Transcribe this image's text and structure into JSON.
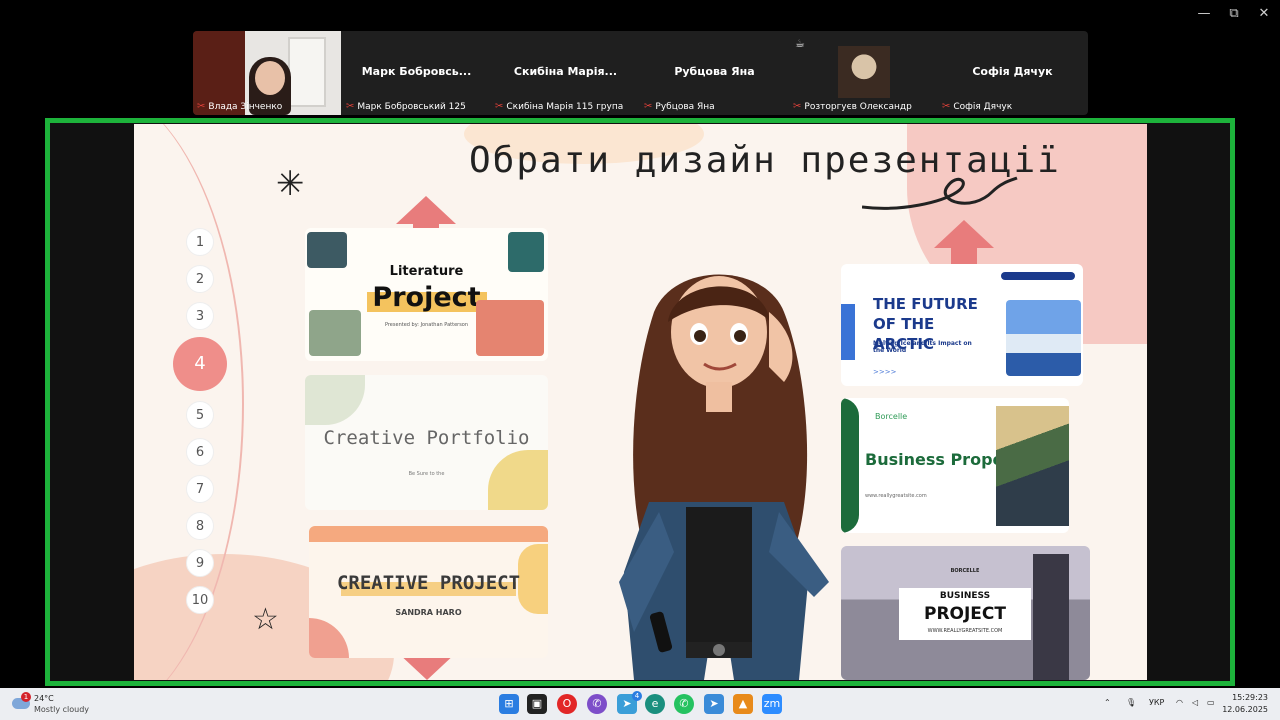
{
  "window": {
    "minimize": "—",
    "maximize": "⧉",
    "close": "✕"
  },
  "participants": {
    "tiles": [
      {
        "big_name": "",
        "label": "Влада Зінченко",
        "video": true
      },
      {
        "big_name": "Марк  Бобровсь...",
        "label": "Марк Бобровський 125"
      },
      {
        "big_name": "Скибіна  Марія...",
        "label": "Скибіна Марія 115 група"
      },
      {
        "big_name": "Рубцова Яна",
        "label": "Рубцова Яна"
      },
      {
        "big_name": "",
        "label": "Розторгуєв Олександр",
        "avatar": true
      },
      {
        "big_name": "Софія Дячук",
        "label": "Софія Дячук"
      }
    ]
  },
  "slide": {
    "title": "Обрати дизайн презентації",
    "numbers": [
      "1",
      "2",
      "3",
      "4",
      "5",
      "6",
      "7",
      "8",
      "9",
      "10"
    ],
    "active_number": "4",
    "cards": {
      "literature": {
        "line1": "Literature",
        "line2": "Project",
        "line3": "Presented by: Jonathan Patterson"
      },
      "portfolio": {
        "line1": "Creative Portfolio",
        "line2": "Be Sure to the"
      },
      "creative": {
        "line1": "CREATIVE PROJECT",
        "line2": "SANDRA HARO"
      },
      "arctic": {
        "line1": "THE FUTURE OF THE ARCTIC",
        "line2": "Melting Ice and Its Impact on the World",
        "line3": ">>>>"
      },
      "business_proposal": {
        "line1": "Business Proposal",
        "line2": "www.reallygreatsite.com",
        "logo": "Borcelle"
      },
      "business_project": {
        "line1": "BUSINESS",
        "line2": "PROJECT",
        "line3": "WWW.REALLYGREATSITE.COM",
        "brand": "BORCELLE"
      }
    }
  },
  "taskbar": {
    "weather_temp": "24°C",
    "weather_desc": "Mostly cloudy",
    "weather_badge": "1",
    "lang": "УКР",
    "time": "15:29:23",
    "date": "12.06.2025",
    "telegram_badge": "4"
  },
  "colors": {
    "share_border": "#1db33b",
    "accent_pink": "#ef8e8a",
    "arrow": "#e87c7c"
  }
}
